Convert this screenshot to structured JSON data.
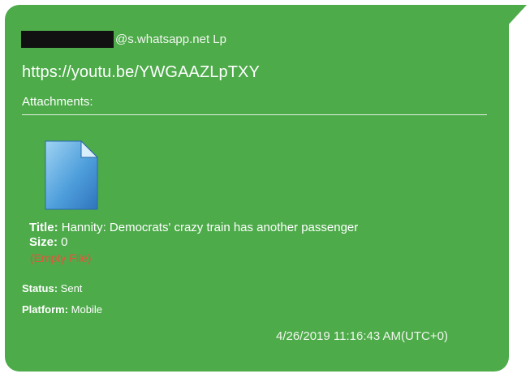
{
  "message": {
    "sender_suffix": "@s.whatsapp.net Lp",
    "body_link": "https://youtu.be/YWGAAZLpTXY",
    "attachments_label": "Attachments:",
    "attachment": {
      "icon": "document-icon",
      "title_label": "Title:",
      "title_value": " Hannity: Democrats' crazy train has another passenger",
      "size_label": "Size:",
      "size_value": " 0",
      "empty_note": "(Empty File)"
    },
    "status_label": "Status:",
    "status_value": " Sent",
    "platform_label": "Platform:",
    "platform_value": " Mobile",
    "timestamp": "4/26/2019 11:16:43 AM(UTC+0)"
  },
  "colors": {
    "bubble": "#4dab4a",
    "empty_file_text": "#e2553b"
  }
}
